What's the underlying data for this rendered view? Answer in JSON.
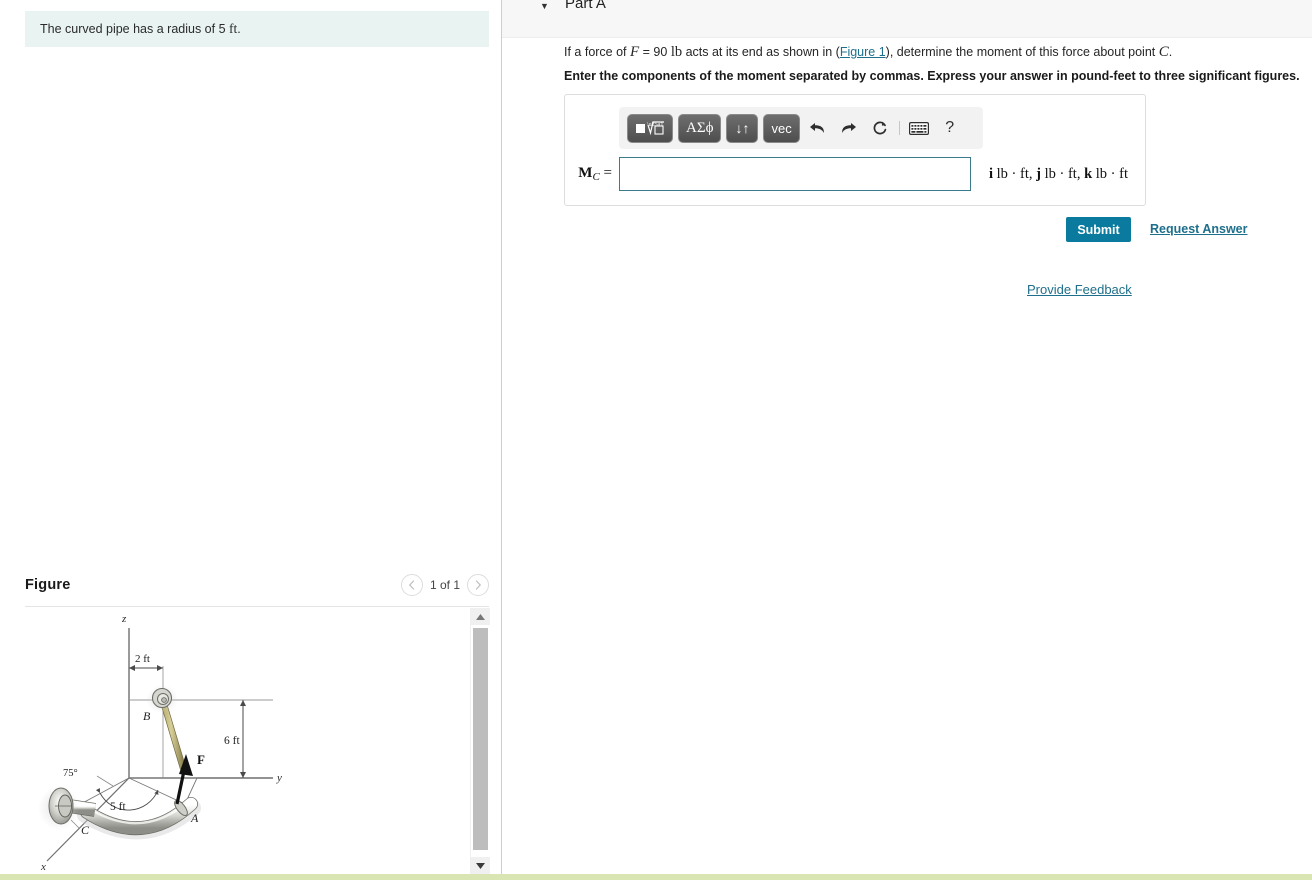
{
  "left": {
    "info_text_pre": "The curved pipe has a radius of 5 ",
    "info_unit": "ft",
    "info_text_post": ".",
    "figure_title": "Figure",
    "pager_label": "1 of 1",
    "prev_icon": "chevron-left-icon",
    "next_icon": "chevron-right-icon",
    "scroll_up_icon": "▲",
    "scroll_down_icon": "▼"
  },
  "figure": {
    "axis_z": "z",
    "axis_y": "y",
    "axis_x": "x",
    "point_a": "A",
    "point_b": "B",
    "point_c": "C",
    "force_label": "F",
    "dim_2ft": "2 ft",
    "dim_6ft": "6 ft",
    "dim_5ft": "5 ft",
    "angle_75": "75°"
  },
  "right": {
    "part_title": "Part A",
    "caret_icon": "▼",
    "question": {
      "p1": "If a force of ",
      "f_sym": "F",
      "p2": " = 90 ",
      "lb": "lb",
      "p3": " acts at its end as shown in (",
      "figure_link": "Figure 1",
      "p4": "), determine the moment of this force about point ",
      "c_sym": "C",
      "p5": "."
    },
    "instruction": "Enter the components of the moment separated by commas. Express your answer in pound-feet to three significant figures.",
    "toolbar": {
      "buttons": [
        {
          "name": "template-button",
          "label": "■√□"
        },
        {
          "name": "greek-button",
          "label": "ΑΣϕ"
        },
        {
          "name": "updown-button",
          "label": "↓↑"
        },
        {
          "name": "vector-button",
          "label": "vec"
        }
      ],
      "icons": [
        {
          "name": "undo-icon",
          "glyph": "↶"
        },
        {
          "name": "redo-icon",
          "glyph": "↷"
        },
        {
          "name": "reset-icon",
          "glyph": "⟳"
        },
        {
          "name": "keyboard-icon",
          "glyph": "⌨"
        },
        {
          "name": "help-icon",
          "glyph": "?"
        }
      ]
    },
    "answer": {
      "label_main": "M",
      "label_sub": "C",
      "equals": "=",
      "value": "",
      "placeholder": "",
      "units": "i lb · ft,  j lb · ft,  k lb · ft",
      "unit_i": "i",
      "unit_j": "j",
      "unit_k": "k",
      "unit_tail": "lb · ft"
    },
    "submit_label": "Submit",
    "request_answer_label": "Request Answer",
    "provide_feedback_label": "Provide Feedback"
  },
  "colors": {
    "accent": "#0a7b9e",
    "link": "#1d6f8b",
    "info_bg": "#e9f4f2",
    "header_bg": "#f7f7f7",
    "input_border": "#3c7a8e",
    "bottom_strip": "#d9e6b4"
  }
}
